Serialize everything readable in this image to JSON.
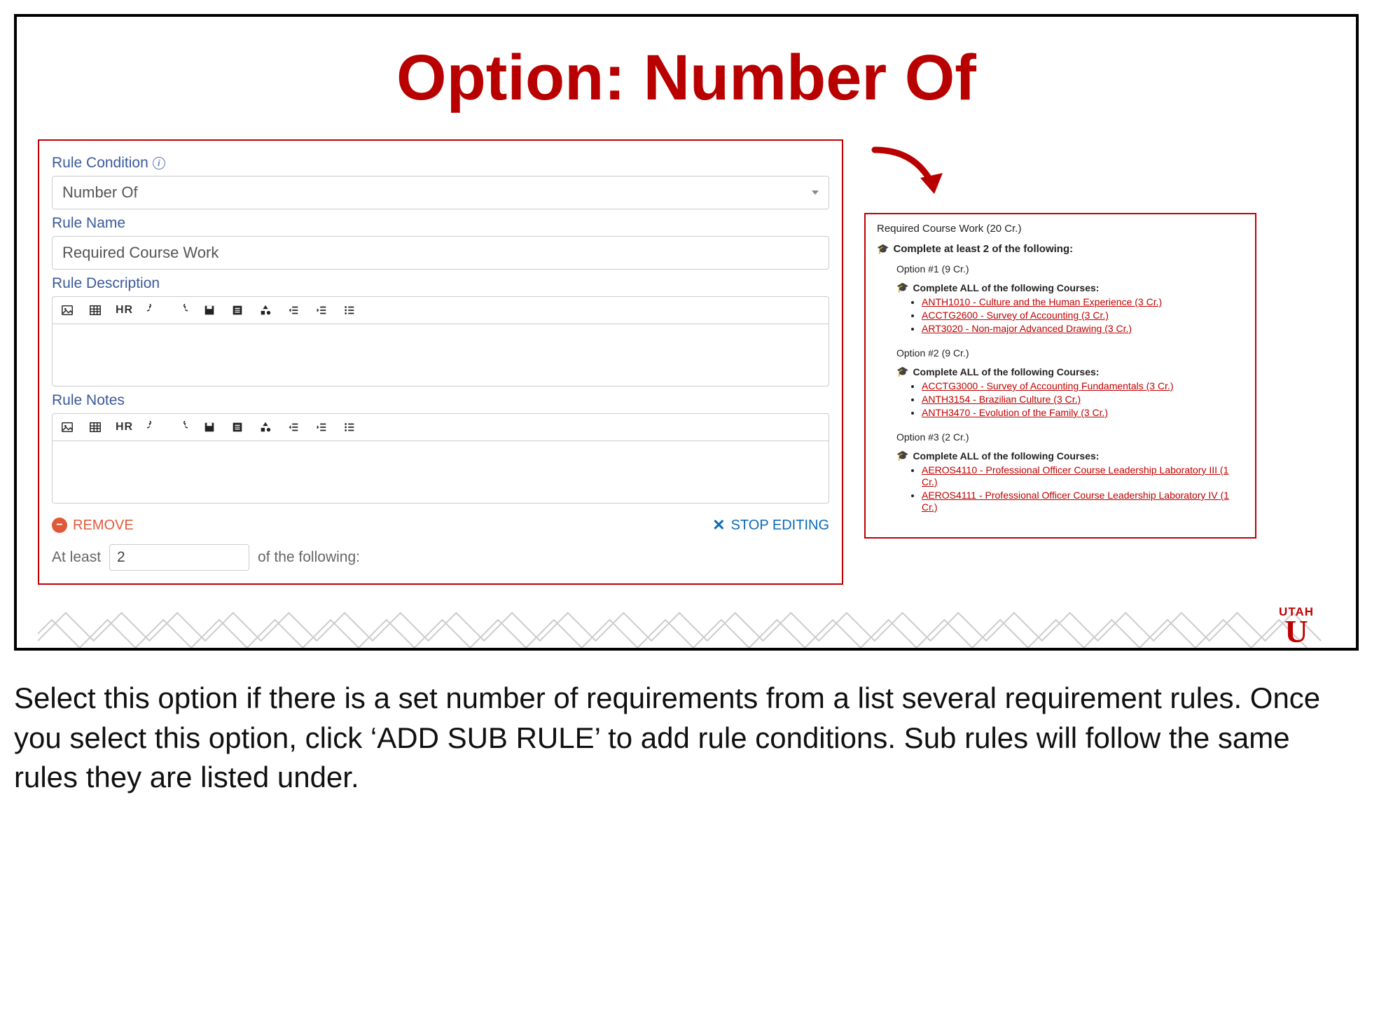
{
  "title": "Option: Number Of",
  "form": {
    "rule_condition_label": "Rule Condition",
    "rule_condition_value": "Number Of",
    "rule_name_label": "Rule Name",
    "rule_name_value": "Required Course Work",
    "rule_description_label": "Rule Description",
    "rule_notes_label": "Rule Notes",
    "toolbar_hr": "HR",
    "remove_label": "REMOVE",
    "stop_label": "STOP EDITING",
    "atleast_prefix": "At least",
    "atleast_value": "2",
    "atleast_suffix": "of the following:"
  },
  "preview": {
    "title": "Required Course Work (20 Cr.)",
    "main_rule": "Complete at least 2 of the following:",
    "options": [
      {
        "label": "Option #1 (9 Cr.)",
        "rule": "Complete ALL of the following Courses:",
        "courses": [
          "ANTH1010 - Culture and the Human Experience (3 Cr.)",
          "ACCTG2600 - Survey of Accounting (3 Cr.)",
          "ART3020 - Non-major Advanced Drawing (3 Cr.)"
        ]
      },
      {
        "label": "Option #2 (9 Cr.)",
        "rule": "Complete ALL of the following Courses:",
        "courses": [
          "ACCTG3000 - Survey of Accounting Fundamentals (3 Cr.)",
          "ANTH3154 - Brazilian Culture (3 Cr.)",
          "ANTH3470 - Evolution of the Family (3 Cr.)"
        ]
      },
      {
        "label": "Option #3 (2 Cr.)",
        "rule": "Complete ALL of the following Courses:",
        "courses": [
          "AEROS4110 - Professional Officer Course Leadership Laboratory III (1 Cr.)",
          "AEROS4111 - Professional Officer Course Leadership Laboratory IV (1 Cr.)"
        ]
      }
    ]
  },
  "logo": {
    "text": "UTAH",
    "letter": "U"
  },
  "caption": "Select this option if there is a set number of requirements from a list several requirement rules. Once you select this option, click ‘ADD SUB RULE’ to add rule conditions. Sub rules will follow the same rules they are listed under."
}
